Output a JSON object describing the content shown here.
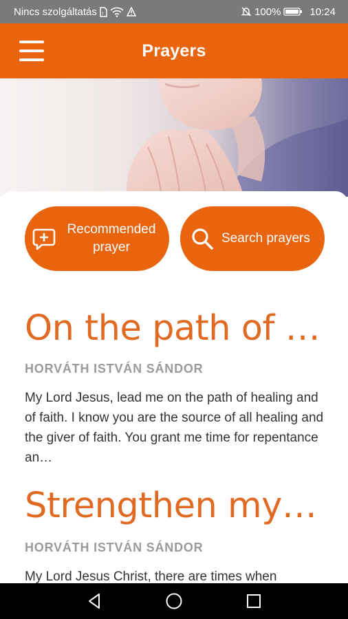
{
  "status_bar": {
    "carrier": "Nincs szolgáltatás",
    "battery": "100%",
    "time": "10:24"
  },
  "app_bar": {
    "title": "Prayers",
    "menu_icon": "hamburger-menu-icon"
  },
  "actions": {
    "recommended_label_line1": "Recommended",
    "recommended_label_line2": "prayer",
    "recommended_icon": "chat-plus-icon",
    "search_label": "Search prayers",
    "search_icon": "search-icon"
  },
  "prayers": [
    {
      "title": "On the path of h...",
      "author": "HORVÁTH ISTVÁN SÁNDOR",
      "text": "My Lord Jesus, lead me on the path of healing and of faith. I know you are the source of all healing and the giver of faith. You grant me time for repentance an…"
    },
    {
      "title": "Strengthen my fai.",
      "author": "HORVÁTH ISTVÁN SÁNDOR",
      "text": "My Lord Jesus Christ, there are times when"
    }
  ],
  "colors": {
    "accent": "#e8640f",
    "title": "#e06a22",
    "author": "#9a9a9a"
  }
}
